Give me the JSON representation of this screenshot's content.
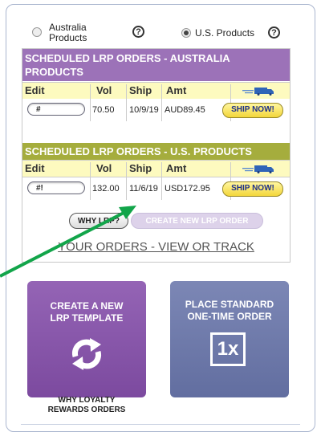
{
  "region_selector": {
    "australia_label": "Australia Products",
    "australia_line1": "Australia",
    "australia_line2": "Products",
    "us_label": "U.S. Products",
    "selected": "U.S. Products",
    "help_glyph": "?"
  },
  "australia_orders": {
    "title_line1": "SCHEDULED LRP ORDERS - AUSTRALIA",
    "title_line2": "PRODUCTS",
    "headers": {
      "edit": "Edit",
      "vol": "Vol",
      "ship": "Ship",
      "amt": "Amt"
    },
    "row": {
      "edit_value": "#",
      "vol": "70.50",
      "ship": "10/9/19",
      "amt": "AUD89.45",
      "ship_now": "SHIP NOW!"
    }
  },
  "us_orders": {
    "title": "SCHEDULED LRP ORDERS - U.S. PRODUCTS",
    "headers": {
      "edit": "Edit",
      "vol": "Vol",
      "ship": "Ship",
      "amt": "Amt"
    },
    "row": {
      "edit_value": "#!",
      "vol": "132.00",
      "ship": "11/6/19",
      "amt": "USD172.95",
      "ship_now": "SHIP NOW!"
    }
  },
  "actions": {
    "why_lrp": "WHY LRP?",
    "create_new_lrp_order": "CREATE NEW LRP ORDER",
    "orders_link": "YOUR ORDERS - VIEW OR TRACK"
  },
  "tiles": {
    "lrp_template_line1": "CREATE A NEW",
    "lrp_template_line2": "LRP TEMPLATE",
    "standard_order_line1": "PLACE STANDARD",
    "standard_order_line2": "ONE-TIME ORDER",
    "one_time_badge": "1x"
  },
  "why_loyalty": {
    "line1": "WHY LOYALTY",
    "line2": "REWARDS ORDERS"
  },
  "colors": {
    "australia_header": "#9c72b8",
    "us_header": "#a5ad3d",
    "header_row_bg": "#fdfabf",
    "ship_now_bg": "#f3d63a",
    "annotation_arrow": "#12a54a"
  },
  "icons": {
    "truck": "delivery-truck-icon",
    "refresh": "refresh-cycle-icon"
  }
}
